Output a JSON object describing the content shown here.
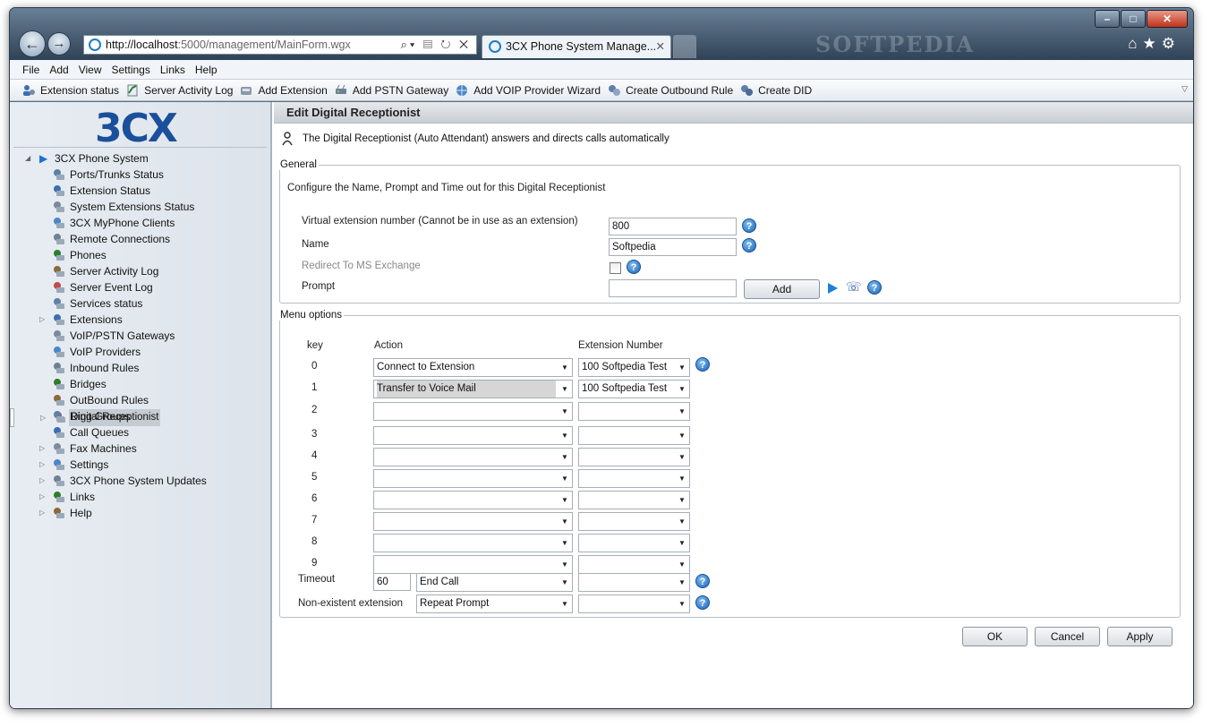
{
  "browser": {
    "address_host": "http://localhost",
    "address_path": ":5000/management/MainForm.wgx",
    "tab_title": "3CX Phone System Manage...",
    "watermark": "SOFTPEDIA"
  },
  "menu": [
    "File",
    "Add",
    "View",
    "Settings",
    "Links",
    "Help"
  ],
  "toolbar": [
    {
      "label": "Extension status",
      "icon": "extension-status-icon"
    },
    {
      "label": "Server Activity Log",
      "icon": "activity-log-icon"
    },
    {
      "label": "Add Extension",
      "icon": "add-extension-icon"
    },
    {
      "label": "Add PSTN Gateway",
      "icon": "pstn-gateway-icon"
    },
    {
      "label": "Add VOIP Provider Wizard",
      "icon": "voip-provider-icon"
    },
    {
      "label": "Create Outbound Rule",
      "icon": "outbound-rule-icon"
    },
    {
      "label": "Create DID",
      "icon": "did-icon"
    }
  ],
  "sidebar": {
    "logo": "3CX",
    "root": "3CX Phone System",
    "items": [
      {
        "label": "Ports/Trunks Status",
        "icon": "ports-icon",
        "expand": false
      },
      {
        "label": "Extension Status",
        "icon": "extension-status-icon",
        "expand": false
      },
      {
        "label": "System Extensions Status",
        "icon": "system-ext-icon",
        "expand": false
      },
      {
        "label": "3CX MyPhone Clients",
        "icon": "myphone-icon",
        "expand": false
      },
      {
        "label": "Remote Connections",
        "icon": "remote-icon",
        "expand": false
      },
      {
        "label": "Phones",
        "icon": "phone-icon",
        "expand": false
      },
      {
        "label": "Server Activity Log",
        "icon": "log-icon",
        "expand": false
      },
      {
        "label": "Server Event Log",
        "icon": "event-log-icon",
        "expand": false
      },
      {
        "label": "Services status",
        "icon": "services-icon",
        "expand": false
      },
      {
        "label": "Extensions",
        "icon": "extensions-icon",
        "expand": true
      },
      {
        "label": "VoIP/PSTN Gateways",
        "icon": "gateway-icon",
        "expand": false
      },
      {
        "label": "VoIP Providers",
        "icon": "provider-icon",
        "expand": false
      },
      {
        "label": "Inbound Rules",
        "icon": "inbound-icon",
        "expand": false
      },
      {
        "label": "Bridges",
        "icon": "bridge-icon",
        "expand": false
      },
      {
        "label": "OutBound Rules",
        "icon": "outbound-icon",
        "expand": false
      },
      {
        "label": "Digital Receptionist",
        "icon": "receptionist-icon",
        "expand": true,
        "selected": true
      },
      {
        "label": "Ring Groups",
        "icon": "ring-group-icon",
        "expand": false
      },
      {
        "label": "Call Queues",
        "icon": "call-queue-icon",
        "expand": false
      },
      {
        "label": "Fax Machines",
        "icon": "fax-icon",
        "expand": true
      },
      {
        "label": "Settings",
        "icon": "settings-icon",
        "expand": true
      },
      {
        "label": "3CX Phone System Updates",
        "icon": "updates-icon",
        "expand": true
      },
      {
        "label": "Links",
        "icon": "links-icon",
        "expand": true
      },
      {
        "label": "Help",
        "icon": "help-icon",
        "expand": true
      }
    ]
  },
  "page": {
    "title": "Edit Digital Receptionist",
    "description": "The Digital Receptionist (Auto Attendant) answers and directs calls automatically"
  },
  "general": {
    "legend": "General",
    "intro": "Configure the Name, Prompt and Time out for this Digital Receptionist",
    "virtual_ext_label": "Virtual extension number (Cannot be in use as an extension)",
    "virtual_ext_value": "800",
    "name_label": "Name",
    "name_value": "Softpedia",
    "redirect_label": "Redirect To MS Exchange",
    "prompt_label": "Prompt",
    "prompt_value": "",
    "add_button": "Add"
  },
  "menu_options": {
    "legend": "Menu options",
    "col_key": "key",
    "col_action": "Action",
    "col_ext": "Extension Number",
    "rows": [
      {
        "key": "0",
        "action": "Connect to Extension",
        "ext": "100 Softpedia Test"
      },
      {
        "key": "1",
        "action": "Transfer to Voice Mail",
        "ext": "100 Softpedia Test"
      },
      {
        "key": "2",
        "action": "",
        "ext": ""
      },
      {
        "key": "3",
        "action": "",
        "ext": ""
      },
      {
        "key": "4",
        "action": "",
        "ext": ""
      },
      {
        "key": "5",
        "action": "",
        "ext": ""
      },
      {
        "key": "6",
        "action": "",
        "ext": ""
      },
      {
        "key": "7",
        "action": "",
        "ext": ""
      },
      {
        "key": "8",
        "action": "",
        "ext": ""
      },
      {
        "key": "9",
        "action": "",
        "ext": ""
      }
    ],
    "timeout_label": "Timeout",
    "timeout_value": "60",
    "timeout_action": "End Call",
    "timeout_ext": "",
    "nonexistent_label": "Non-existent extension",
    "nonexistent_action": "Repeat Prompt",
    "nonexistent_ext": ""
  },
  "buttons": {
    "ok": "OK",
    "cancel": "Cancel",
    "apply": "Apply"
  },
  "colors": {
    "brand": "#1b4f9b",
    "help": "#1c63b7"
  }
}
